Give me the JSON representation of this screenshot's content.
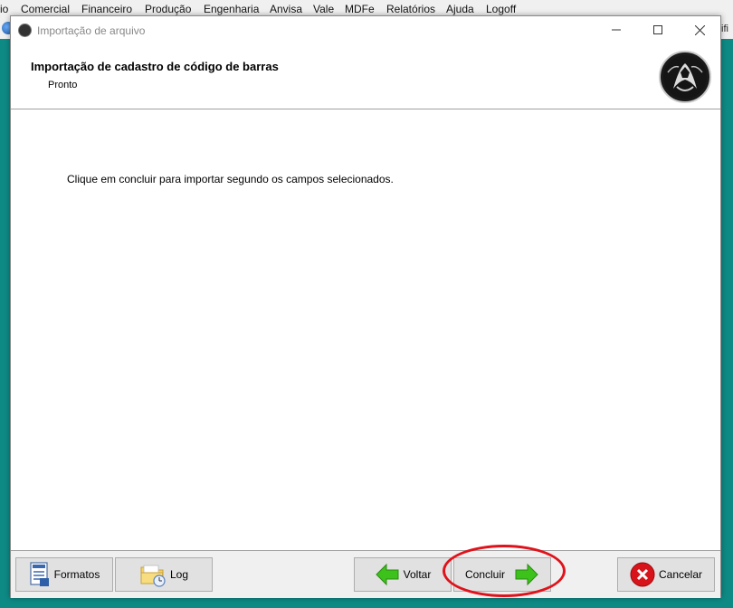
{
  "background_app": {
    "menu": [
      "io",
      "Comercial",
      "Financeiro",
      "Produção",
      "Engenharia",
      "Anvisa",
      "Vale",
      "MDFe",
      "Relatórios",
      "Ajuda",
      "Logoff"
    ],
    "right_text": "tifi"
  },
  "window": {
    "title": "Importação de arquivo",
    "controls": {
      "minimize": "—",
      "maximize": "☐",
      "close": "✕"
    }
  },
  "header": {
    "title": "Importação de cadastro de código de barras",
    "subtitle": "Pronto"
  },
  "content": {
    "message": "Clique em concluir para importar segundo os campos selecionados."
  },
  "footer": {
    "formatos": "Formatos",
    "log": "Log",
    "voltar": "Voltar",
    "concluir": "Concluir",
    "cancelar": "Cancelar"
  },
  "colors": {
    "desktop": "#0e8a85",
    "highlight": "#e0121b",
    "arrow": "#3cc21a",
    "cancel": "#d8141b"
  }
}
